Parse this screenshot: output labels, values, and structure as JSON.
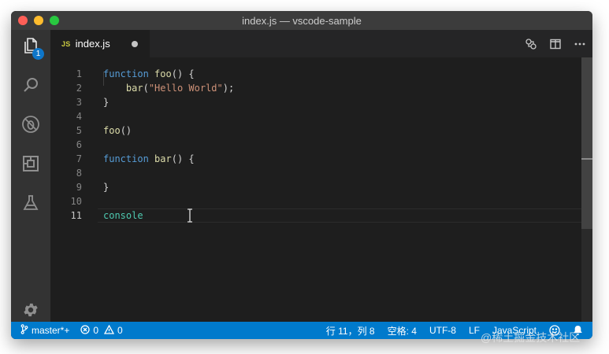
{
  "window": {
    "title": "index.js — vscode-sample"
  },
  "activity_bar": {
    "items": [
      {
        "icon": "files-icon",
        "badge": "1"
      },
      {
        "icon": "search-icon"
      },
      {
        "icon": "debug-icon"
      },
      {
        "icon": "extensions-icon"
      },
      {
        "icon": "flask-icon"
      }
    ],
    "settings_icon": "gear-icon"
  },
  "tabs": [
    {
      "file_type": "JS",
      "label": "index.js",
      "dirty": true
    }
  ],
  "tab_actions": [
    "open-changes-icon",
    "split-editor-icon",
    "more-icon"
  ],
  "editor": {
    "lines": [
      {
        "n": "1",
        "parts": [
          {
            "t": "function",
            "c": "kw"
          },
          {
            "t": " "
          },
          {
            "t": "foo",
            "c": "fn"
          },
          {
            "t": "() {"
          }
        ]
      },
      {
        "n": "2",
        "parts": [
          {
            "t": "    "
          },
          {
            "t": "bar",
            "c": "fn"
          },
          {
            "t": "("
          },
          {
            "t": "\"Hello World\"",
            "c": "str"
          },
          {
            "t": ");"
          }
        ]
      },
      {
        "n": "3",
        "parts": [
          {
            "t": "}"
          }
        ]
      },
      {
        "n": "4",
        "parts": []
      },
      {
        "n": "5",
        "parts": [
          {
            "t": "foo",
            "c": "fn"
          },
          {
            "t": "()"
          }
        ]
      },
      {
        "n": "6",
        "parts": []
      },
      {
        "n": "7",
        "parts": [
          {
            "t": "function",
            "c": "kw"
          },
          {
            "t": " "
          },
          {
            "t": "bar",
            "c": "fn"
          },
          {
            "t": "() {"
          }
        ]
      },
      {
        "n": "8",
        "parts": []
      },
      {
        "n": "9",
        "parts": [
          {
            "t": "}"
          }
        ]
      },
      {
        "n": "10",
        "parts": []
      },
      {
        "n": "11",
        "parts": [
          {
            "t": "console",
            "c": "obj"
          }
        ]
      }
    ],
    "current_line": "11"
  },
  "status_bar": {
    "branch": "master*+",
    "errors": "0",
    "warnings": "0",
    "position": "行 11，列 8",
    "indent": "空格: 4",
    "encoding": "UTF-8",
    "eol": "LF",
    "language": "JavaScript"
  },
  "watermark": "@稀土掘金技术社区",
  "colors": {
    "status_bar": "#007acc",
    "editor_bg": "#1e1e1e",
    "activity_bar": "#333333",
    "keyword": "#569cd6",
    "function": "#dcdcaa",
    "string": "#ce9178",
    "type": "#4ec9b0"
  }
}
